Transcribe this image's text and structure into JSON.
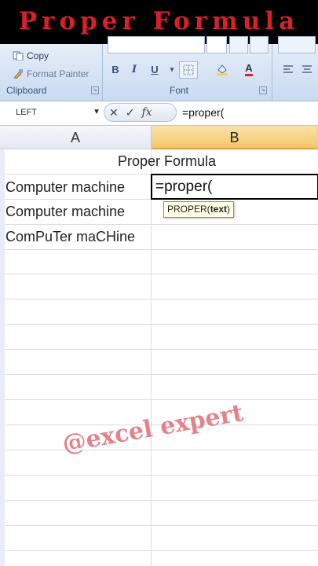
{
  "banner": {
    "title": "Proper Formula"
  },
  "ribbon": {
    "clipboard": {
      "copy_label": "Copy",
      "format_painter_label": "Format Painter",
      "group_label": "Clipboard"
    },
    "font": {
      "group_label": "Font",
      "bold": "B",
      "italic": "I",
      "underline": "U",
      "font_color": "A"
    }
  },
  "formula_bar": {
    "name_box": "LEFT",
    "fx_label": "fx",
    "cancel_glyph": "✕",
    "enter_glyph": "✓",
    "formula": "=proper("
  },
  "columns": [
    {
      "label": "A"
    },
    {
      "label": "B"
    }
  ],
  "cells": {
    "b1": "Proper Formula",
    "a2": "Computer machine",
    "b2_editing": "=proper(",
    "a3": "Computer machine",
    "a4": "ComPuTer maCHine"
  },
  "tooltip": {
    "fn": "PROPER(",
    "arg": "text",
    "close": ")"
  },
  "watermark": "@excel expert",
  "colors": {
    "banner_title": "#d81f2a",
    "active_header": "#f4c668",
    "watermark": "#de6c76"
  }
}
